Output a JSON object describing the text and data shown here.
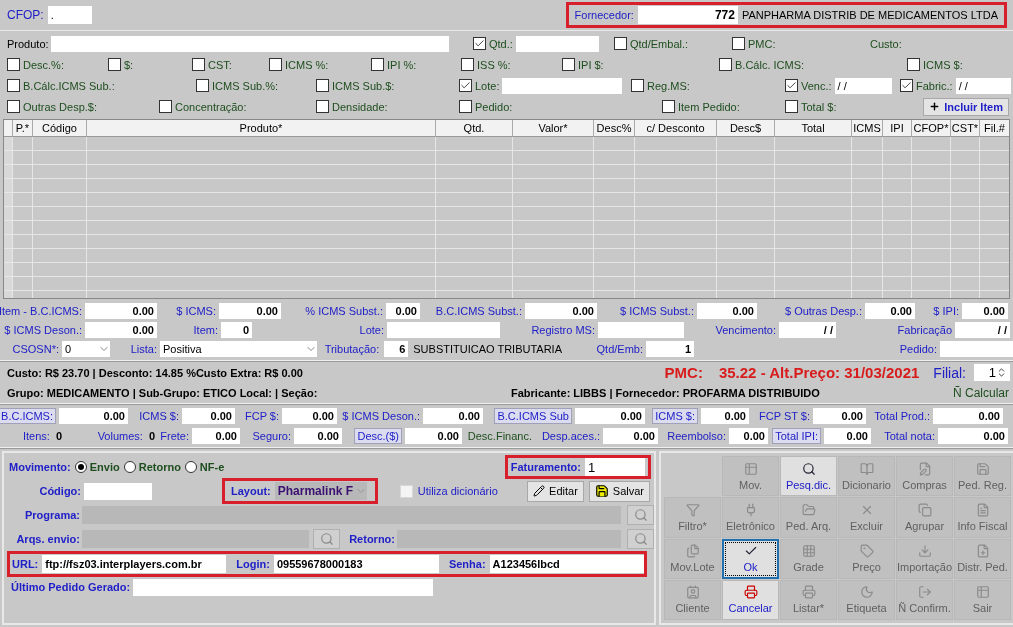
{
  "header": {
    "cfop": {
      "label": "CFOP:",
      "value": "."
    },
    "fornecedor": {
      "label": "Fornecedor:",
      "code": "772",
      "name": "PANPHARMA DISTRIB DE MEDICAMENTOS LTDA",
      "highlighted": true
    }
  },
  "options": [
    {
      "items": [
        {
          "kind": "field",
          "label": "Produto:"
        },
        {
          "kind": "check_field",
          "label": "Qtd.:",
          "checked": true
        },
        {
          "kind": "check",
          "label": "Qtd/Embal.:",
          "checked": false
        },
        {
          "kind": "check",
          "label": "PMC:",
          "checked": false
        },
        {
          "kind": "label",
          "label": "Custo:"
        }
      ]
    },
    {
      "items": [
        {
          "kind": "check",
          "label": "Desc.%:",
          "checked": false
        },
        {
          "kind": "check",
          "label": "$:",
          "checked": false
        },
        {
          "kind": "check",
          "label": "CST:",
          "checked": false
        },
        {
          "kind": "check",
          "label": "ICMS %:",
          "checked": false
        },
        {
          "kind": "check",
          "label": "IPI %:",
          "checked": false
        },
        {
          "kind": "check",
          "label": "ISS %:",
          "checked": false
        },
        {
          "kind": "check",
          "label": "IPI $:",
          "checked": false
        },
        {
          "kind": "check",
          "label": "B.Cálc. ICMS:",
          "checked": false
        },
        {
          "kind": "check",
          "label": "ICMS $:",
          "checked": false
        }
      ]
    },
    {
      "items": [
        {
          "kind": "check",
          "label": "B.Cálc.ICMS Sub.:",
          "checked": false
        },
        {
          "kind": "check",
          "label": "ICMS Sub.%:",
          "checked": false
        },
        {
          "kind": "check",
          "label": "ICMS Sub.$:",
          "checked": false
        },
        {
          "kind": "check_field",
          "label": "Lote:",
          "checked": true
        },
        {
          "kind": "check",
          "label": "Reg.MS:",
          "checked": false
        },
        {
          "kind": "check_field",
          "label": "Venc.:",
          "checked": true,
          "value": "/ /"
        },
        {
          "kind": "check_field",
          "label": "Fabric.:",
          "checked": true,
          "value": "/ /"
        }
      ]
    },
    {
      "items": [
        {
          "kind": "check",
          "label": "Outras Desp.$:",
          "checked": false
        },
        {
          "kind": "check",
          "label": "Concentração:",
          "checked": false
        },
        {
          "kind": "check",
          "label": "Densidade:",
          "checked": false
        },
        {
          "kind": "check",
          "label": "Pedido:",
          "checked": false
        },
        {
          "kind": "check",
          "label": "Item Pedido:",
          "checked": false
        },
        {
          "kind": "check",
          "label": "Total $:",
          "checked": false
        },
        {
          "kind": "button",
          "label": "Incluir Item"
        }
      ]
    }
  ],
  "table": {
    "columns": [
      "P.*",
      "Código",
      "Produto*",
      "Qtd.",
      "Valor*",
      "Desc%",
      "c/ Desconto",
      "Desc$",
      "Total",
      "ICMS",
      "IPI",
      "CFOP*",
      "CST*",
      "Fil.#"
    ]
  },
  "item_totals": [
    {
      "items": [
        {
          "kind": "field",
          "label": "Item - B.C.ICMS:",
          "value": "0.00"
        },
        {
          "kind": "field",
          "label": "$ ICMS:",
          "value": "0.00"
        },
        {
          "kind": "field",
          "label": "% ICMS Subst.:",
          "value": "0.00"
        },
        {
          "kind": "field",
          "label": "B.C.ICMS Subst.:",
          "value": "0.00"
        },
        {
          "kind": "field",
          "label": "$ ICMS Subst.:",
          "value": "0.00"
        },
        {
          "kind": "field",
          "label": "$ Outras Desp.:",
          "value": "0.00"
        },
        {
          "kind": "field",
          "label": "$ IPI:",
          "value": "0.00"
        }
      ]
    },
    {
      "items": [
        {
          "kind": "field",
          "label": "$ ICMS Deson.:",
          "value": "0.00"
        },
        {
          "kind": "field",
          "label": "Item:",
          "value": "0"
        },
        {
          "kind": "field",
          "label": "Lote:"
        },
        {
          "kind": "field",
          "label": "Registro MS:"
        },
        {
          "kind": "field",
          "label": "Vencimento:",
          "value": "/ /"
        },
        {
          "kind": "field",
          "label": "Fabricação",
          "value": "/ /"
        }
      ]
    },
    {
      "items": [
        {
          "kind": "select",
          "label": "CSOSN*:",
          "value": "0"
        },
        {
          "kind": "select",
          "label": "Lista:",
          "value": "Positiva"
        },
        {
          "kind": "code",
          "label": "Tributação:",
          "value": "6",
          "description": "SUBSTITUICAO TRIBUTARIA"
        },
        {
          "kind": "field",
          "label": "Qtd/Emb:",
          "value": "1"
        },
        {
          "kind": "field",
          "label": "Pedido:"
        }
      ]
    }
  ],
  "info": {
    "cost_line": "Custo:  R$ 23.70 |  Desconto:  14.85 %Custo Extra:  R$ 0.00",
    "pmc_label": "PMC:",
    "pmc_value": "35.22 - Alt.Preço: 31/03/2021",
    "filial_label": "Filial:",
    "filial_value": "1",
    "group_line": "Grupo: MEDICAMENTO  |  Sub-Grupo: ETICO Local:  |  Seção:",
    "maker_line": "Fabricante: LIBBS |  Fornecedor: PROFARMA DISTRIBUIDO",
    "calc_link": "Ñ Calcular"
  },
  "note_totals": [
    {
      "items": [
        {
          "kind": "boxed_field",
          "label": "B.C.ICMS:",
          "value": "0.00"
        },
        {
          "kind": "field",
          "label": "ICMS $:",
          "value": "0.00"
        },
        {
          "kind": "field",
          "label": "FCP $:",
          "value": "0.00"
        },
        {
          "kind": "field",
          "label": "$ ICMS Deson.:",
          "value": "0.00"
        },
        {
          "kind": "boxed_field",
          "label": "B.C.ICMS Sub",
          "value": "0.00"
        },
        {
          "kind": "boxed_field",
          "label": "ICMS $:",
          "value": "0.00"
        },
        {
          "kind": "field",
          "label": "FCP ST $:",
          "value": "0.00"
        },
        {
          "kind": "field",
          "label": "Total Prod.:",
          "value": "0.00"
        }
      ]
    },
    {
      "items": [
        {
          "kind": "plain",
          "label": "Itens:",
          "value": "0"
        },
        {
          "kind": "plain",
          "label": "Volumes:",
          "value": "0"
        },
        {
          "kind": "field",
          "label": "Frete:",
          "value": "0.00"
        },
        {
          "kind": "field",
          "label": "Seguro:",
          "value": "0.00"
        },
        {
          "kind": "boxed_field",
          "label": "Desc.($)",
          "value": "0.00"
        },
        {
          "kind": "note",
          "label": "Desc.Financ."
        },
        {
          "kind": "field",
          "label": "Desp.aces.:",
          "value": "0.00"
        },
        {
          "kind": "field",
          "label": "Reembolso:",
          "value": "0.00"
        },
        {
          "kind": "boxed_field",
          "label": "Total IPI:",
          "value": "0.00"
        },
        {
          "kind": "field",
          "label": "Total nota:",
          "value": "0.00"
        }
      ]
    }
  ],
  "transfer": {
    "movimento_label": "Movimento:",
    "movimento": [
      {
        "label": "Envio",
        "selected": true
      },
      {
        "label": "Retorno",
        "selected": false
      },
      {
        "label": "NF-e",
        "selected": false
      }
    ],
    "faturamento": {
      "label": "Faturamento:",
      "value": "1",
      "highlighted": true
    },
    "codigo_label": "Código:",
    "layout": {
      "label": "Layout:",
      "value": "Pharmalink F",
      "disabled": true,
      "highlighted": true
    },
    "dicionario": {
      "label": "Utiliza dicionário",
      "checked": false
    },
    "buttons": [
      "Editar",
      "Salvar"
    ],
    "programa": {
      "label": "Programa:",
      "disabled": true
    },
    "arqs_envio": {
      "label": "Arqs. envio:",
      "disabled": true
    },
    "retorno": {
      "label": "Retorno:",
      "disabled": true
    },
    "access": {
      "highlighted": true,
      "url_label": "URL:",
      "url": "ftp://fsz03.interplayers.com.br",
      "login_label": "Login:",
      "login": "09559678000183",
      "senha_label": "Senha:",
      "senha": "A123456lbcd"
    },
    "ultimo_label": "Último Pedido Gerado:"
  },
  "toolbar_buttons": [
    {
      "label": "Mov.",
      "disabled": true,
      "focused": false
    },
    {
      "label": "Pesq.dic.",
      "disabled": false,
      "focused": false
    },
    {
      "label": "Dicionario",
      "disabled": true,
      "focused": false
    },
    {
      "label": "Compras",
      "disabled": true,
      "focused": false
    },
    {
      "label": "Ped. Reg.",
      "disabled": true,
      "focused": false
    },
    {
      "label": "Filtro*",
      "disabled": true,
      "focused": false
    },
    {
      "label": "Eletrônico",
      "disabled": true,
      "focused": false
    },
    {
      "label": "Ped. Arq.",
      "disabled": true,
      "focused": false
    },
    {
      "label": "Excluir",
      "disabled": true,
      "focused": false
    },
    {
      "label": "Agrupar",
      "disabled": true,
      "focused": false
    },
    {
      "label": "Info Fiscal",
      "disabled": true,
      "focused": false
    },
    {
      "label": "Mov.Lote",
      "disabled": true,
      "focused": false
    },
    {
      "label": "Ok",
      "disabled": false,
      "focused": true
    },
    {
      "label": "Grade",
      "disabled": true,
      "focused": false
    },
    {
      "label": "Preço",
      "disabled": true,
      "focused": false
    },
    {
      "label": "Importação",
      "disabled": true,
      "focused": false
    },
    {
      "label": "Distr. Ped.",
      "disabled": true,
      "focused": false
    },
    {
      "label": "Cliente",
      "disabled": true,
      "focused": false
    },
    {
      "label": "Cancelar",
      "disabled": false,
      "focused": false
    },
    {
      "label": "Listar*",
      "disabled": true,
      "focused": false
    },
    {
      "label": "Etiqueta",
      "disabled": true,
      "focused": false
    },
    {
      "label": "Ñ Confirm.",
      "disabled": true,
      "focused": false
    },
    {
      "label": "Sair",
      "disabled": true,
      "focused": false
    }
  ]
}
